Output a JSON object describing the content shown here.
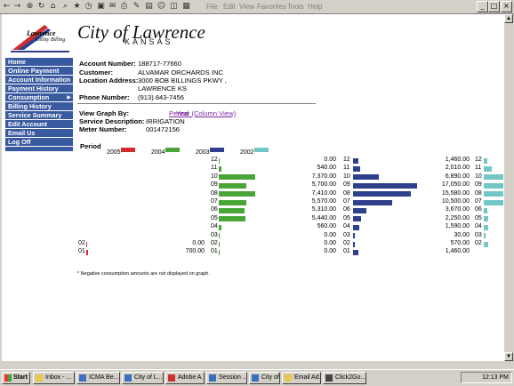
{
  "browser": {
    "menu": [
      "File",
      "Edit",
      "View",
      "Favorites",
      "Tools",
      "Help"
    ],
    "window_controls": [
      "_",
      "□",
      "×"
    ]
  },
  "header": {
    "logo_line1": "Lawrence",
    "logo_line2": "Utility Billing",
    "city_title": "City of Lawrence",
    "state": "KANSAS"
  },
  "nav": [
    {
      "label": "Home",
      "big": false
    },
    {
      "label": "Online Payment",
      "big": true
    },
    {
      "label": "Account Information",
      "big": false
    },
    {
      "label": "Payment History",
      "big": false
    },
    {
      "label": "Consumption",
      "big": false,
      "active": true
    },
    {
      "label": "Billing History",
      "big": false
    },
    {
      "label": "Service Summary",
      "big": false
    },
    {
      "label": "Edit Account",
      "big": false
    },
    {
      "label": "Email Us",
      "big": false
    },
    {
      "label": "Log Off",
      "big": false
    }
  ],
  "account": {
    "number_label": "Account Number:",
    "number": "188717-77660",
    "customer_label": "Customer:",
    "customer": "ALVAMAR ORCHARDS INC",
    "location_label": "Location Address:",
    "location_line1": "3000 BOB BILLINGS PKWY ,",
    "location_line2": "LAWRENCE KS",
    "phone_label": "Phone Number:",
    "phone": "(913) 843-7456"
  },
  "graph_options": {
    "view_label": "View Graph By:",
    "link_period": "Period",
    "link_year": "Year (Column View)",
    "service_label": "Service Description:",
    "service": "IRRIGATION",
    "meter_label": "Meter Number:",
    "meter": "001472156"
  },
  "chart_data": {
    "type": "bar",
    "title": "",
    "legend_title": "Period",
    "orientation": "horizontal",
    "layout": "small multiples, one column per year",
    "categories": [
      "12",
      "11",
      "10",
      "09",
      "08",
      "07",
      "06",
      "05",
      "04",
      "03",
      "02",
      "01"
    ],
    "series": [
      {
        "name": "2005",
        "color": "#d02b2b",
        "rows": [
          {
            "period": "02",
            "value": "0.00"
          },
          {
            "period": "01",
            "value": "700.00"
          }
        ]
      },
      {
        "name": "2004",
        "color": "#4aa538",
        "rows": [
          {
            "period": "12",
            "value": "0.00"
          },
          {
            "period": "11",
            "value": "540.00"
          },
          {
            "period": "10",
            "value": "7,370.00"
          },
          {
            "period": "09",
            "value": "5,700.00"
          },
          {
            "period": "08",
            "value": "7,410.00"
          },
          {
            "period": "07",
            "value": "5,570.00"
          },
          {
            "period": "06",
            "value": "5,310.00"
          },
          {
            "period": "05",
            "value": "5,440.00"
          },
          {
            "period": "04",
            "value": "560.00"
          },
          {
            "period": "03",
            "value": "0.00"
          },
          {
            "period": "02",
            "value": "0.00"
          },
          {
            "period": "01",
            "value": "0.00"
          }
        ]
      },
      {
        "name": "2003",
        "color": "#2e3f8c",
        "rows": [
          {
            "period": "12",
            "value": "1,460.00"
          },
          {
            "period": "11",
            "value": "2,010.00"
          },
          {
            "period": "10",
            "value": "6,890.00"
          },
          {
            "period": "09",
            "value": "17,050.00"
          },
          {
            "period": "08",
            "value": "15,580.00"
          },
          {
            "period": "07",
            "value": "10,500.00"
          },
          {
            "period": "06",
            "value": "3,670.00"
          },
          {
            "period": "05",
            "value": "2,250.00"
          },
          {
            "period": "04",
            "value": "1,590.00"
          },
          {
            "period": "03",
            "value": "30.00"
          },
          {
            "period": "02",
            "value": "570.00"
          },
          {
            "period": "01",
            "value": "1,460.00"
          }
        ]
      },
      {
        "name": "2002",
        "color": "#73c6c6",
        "rows": [
          {
            "period": "12"
          },
          {
            "period": "11"
          },
          {
            "period": "10"
          },
          {
            "period": "09"
          },
          {
            "period": "08"
          },
          {
            "period": "07"
          },
          {
            "period": "06"
          },
          {
            "period": "05"
          },
          {
            "period": "04"
          },
          {
            "period": "03"
          },
          {
            "period": "02"
          }
        ]
      }
    ],
    "visible_bars_2002_relative": [
      0.15,
      0.35,
      0.99,
      0.99,
      0.99,
      0.99,
      0.15,
      0.2,
      0.2,
      0.08,
      0.2
    ],
    "footnote": "* Negative consumption amounts are not displayed on graph."
  },
  "taskbar": {
    "start": "Start",
    "items": [
      "Inbox - ...",
      "ICMA Be...",
      "City of L...",
      "Adobe A...",
      "Session ...",
      "City of L...",
      "Email Ad...",
      "Click2Go..."
    ],
    "clock": "12:13 PM"
  }
}
